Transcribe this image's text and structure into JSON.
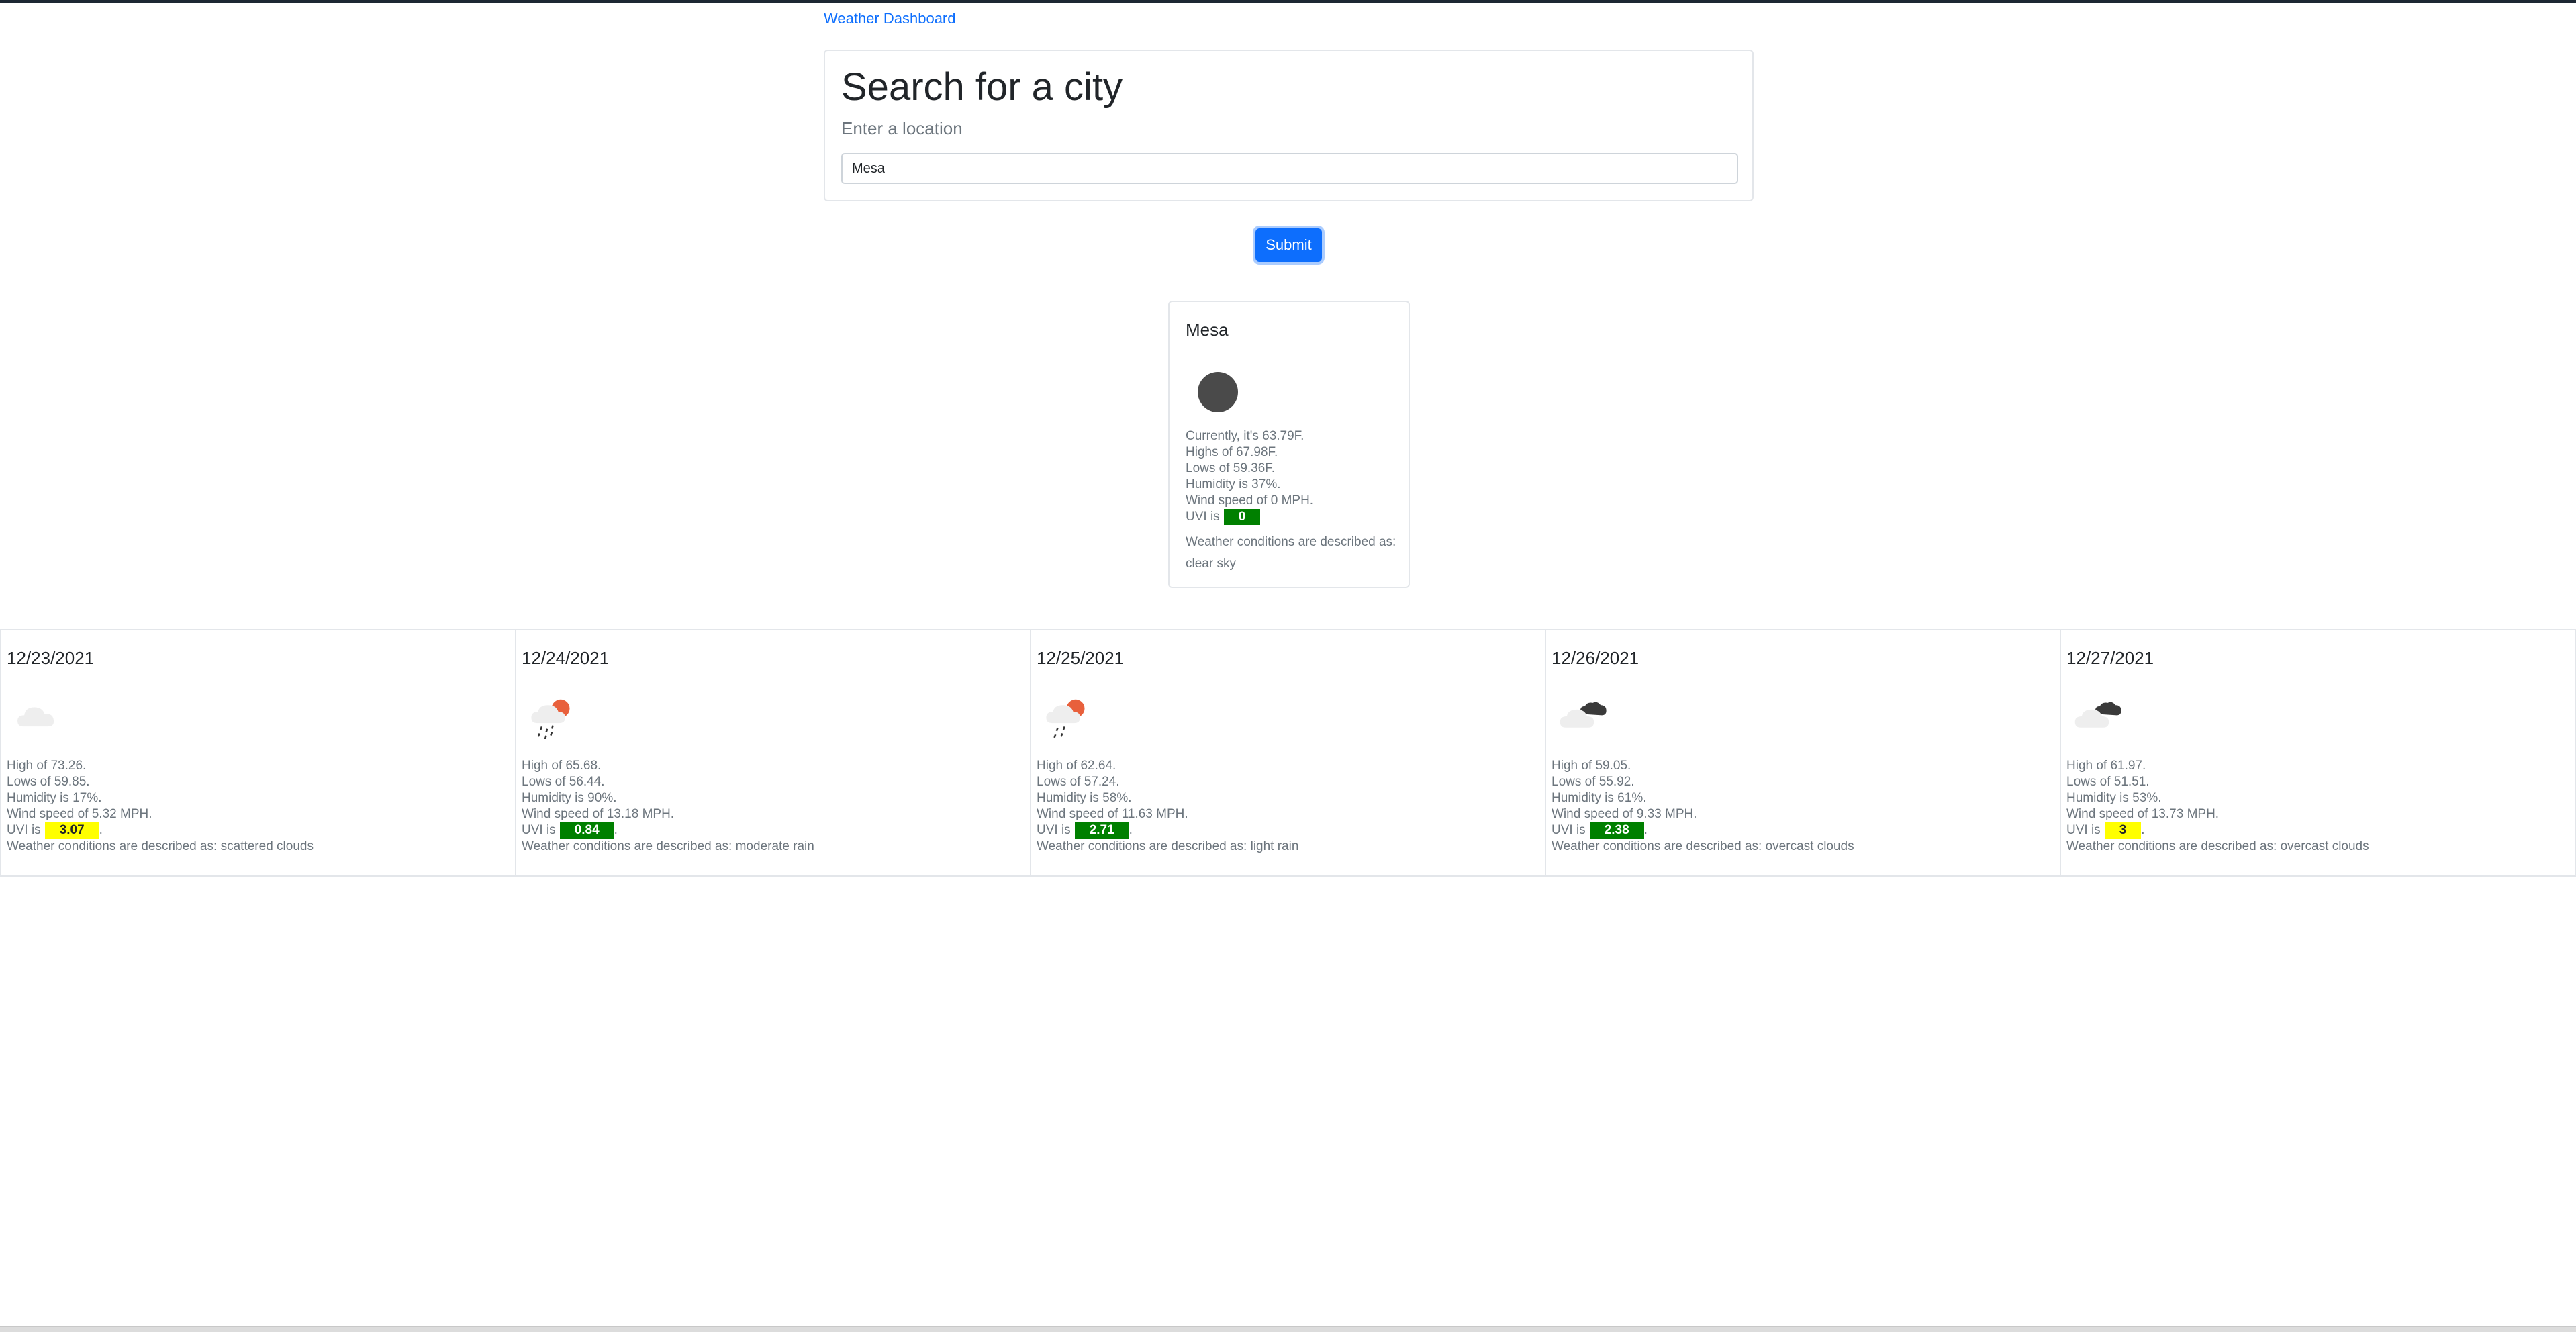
{
  "nav": {
    "brand": "Weather Dashboard"
  },
  "search": {
    "title": "Search for a city",
    "subtitle": "Enter a location",
    "input_value": "Mesa",
    "submit_label": "Submit"
  },
  "current": {
    "city": "Mesa",
    "icon": "clear-sky-icon",
    "currently": "Currently, it's 63.79F.",
    "highs": "Highs of 67.98F.",
    "lows": "Lows of 59.36F.",
    "humidity": "Humidity is 37%.",
    "wind": "Wind speed of 0 MPH.",
    "uvi_prefix": "UVI is",
    "uvi_value": "0",
    "uvi_color": "#008000",
    "description": "Weather conditions are described as: clear sky"
  },
  "forecast": [
    {
      "date": "12/23/2021",
      "icon": "scattered-clouds-icon",
      "high": "High of 73.26.",
      "low": "Lows of 59.85.",
      "humidity": "Humidity is 17%.",
      "wind": "Wind speed of 5.32 MPH.",
      "uvi_prefix": "UVI is",
      "uvi_value": "3.07",
      "uvi_suffix": ".",
      "uvi_color": "#ffff00",
      "description": "Weather conditions are described as: scattered clouds"
    },
    {
      "date": "12/24/2021",
      "icon": "moderate-rain-icon",
      "high": "High of 65.68.",
      "low": "Lows of 56.44.",
      "humidity": "Humidity is 90%.",
      "wind": "Wind speed of 13.18 MPH.",
      "uvi_prefix": "UVI is",
      "uvi_value": "0.84",
      "uvi_suffix": ".",
      "uvi_color": "#008000",
      "description": "Weather conditions are described as: moderate rain"
    },
    {
      "date": "12/25/2021",
      "icon": "light-rain-icon",
      "high": "High of 62.64.",
      "low": "Lows of 57.24.",
      "humidity": "Humidity is 58%.",
      "wind": "Wind speed of 11.63 MPH.",
      "uvi_prefix": "UVI is",
      "uvi_value": "2.71",
      "uvi_suffix": ".",
      "uvi_color": "#008000",
      "description": "Weather conditions are described as: light rain"
    },
    {
      "date": "12/26/2021",
      "icon": "overcast-clouds-icon",
      "high": "High of 59.05.",
      "low": "Lows of 55.92.",
      "humidity": "Humidity is 61%.",
      "wind": "Wind speed of 9.33 MPH.",
      "uvi_prefix": "UVI is",
      "uvi_value": "2.38",
      "uvi_suffix": ".",
      "uvi_color": "#008000",
      "description": "Weather conditions are described as: overcast clouds"
    },
    {
      "date": "12/27/2021",
      "icon": "overcast-clouds-icon",
      "high": "High of 61.97.",
      "low": "Lows of 51.51.",
      "humidity": "Humidity is 53%.",
      "wind": "Wind speed of 13.73 MPH.",
      "uvi_prefix": "UVI is",
      "uvi_value": "3",
      "uvi_suffix": ".",
      "uvi_color": "#ffff00",
      "description": "Weather conditions are described as: overcast clouds"
    }
  ]
}
